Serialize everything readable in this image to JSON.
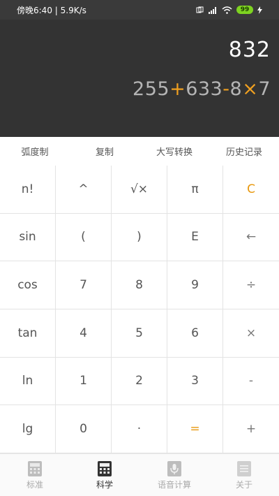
{
  "status": {
    "time_speed": "傍晚6:40 | 5.9K/s",
    "battery": "99"
  },
  "display": {
    "result": "832",
    "expression": [
      {
        "t": "255",
        "op": false
      },
      {
        "t": "+",
        "op": true
      },
      {
        "t": "633",
        "op": false
      },
      {
        "t": "-",
        "op": true
      },
      {
        "t": "8",
        "op": false
      },
      {
        "t": "×",
        "op": true
      },
      {
        "t": "7",
        "op": false
      }
    ]
  },
  "toolbar": {
    "items": [
      "弧度制",
      "复制",
      "大写转换",
      "历史记录"
    ]
  },
  "keypad": {
    "keys": [
      "n!",
      "^",
      "√×",
      "π",
      "C",
      "sin",
      "(",
      ")",
      "E",
      "←",
      "cos",
      "7",
      "8",
      "9",
      "÷",
      "tan",
      "4",
      "5",
      "6",
      "×",
      "ln",
      "1",
      "2",
      "3",
      "-",
      "lg",
      "0",
      "·",
      "=",
      "+"
    ]
  },
  "bottom_nav": {
    "items": [
      {
        "label": "标准",
        "icon": "calculator-icon",
        "active": false
      },
      {
        "label": "科学",
        "icon": "scientific-calculator-icon",
        "active": true
      },
      {
        "label": "语音计算",
        "icon": "microphone-icon",
        "active": false
      },
      {
        "label": "关于",
        "icon": "about-icon",
        "active": false
      }
    ]
  },
  "colors": {
    "accent": "#e8980e",
    "display_bg": "#333333"
  }
}
